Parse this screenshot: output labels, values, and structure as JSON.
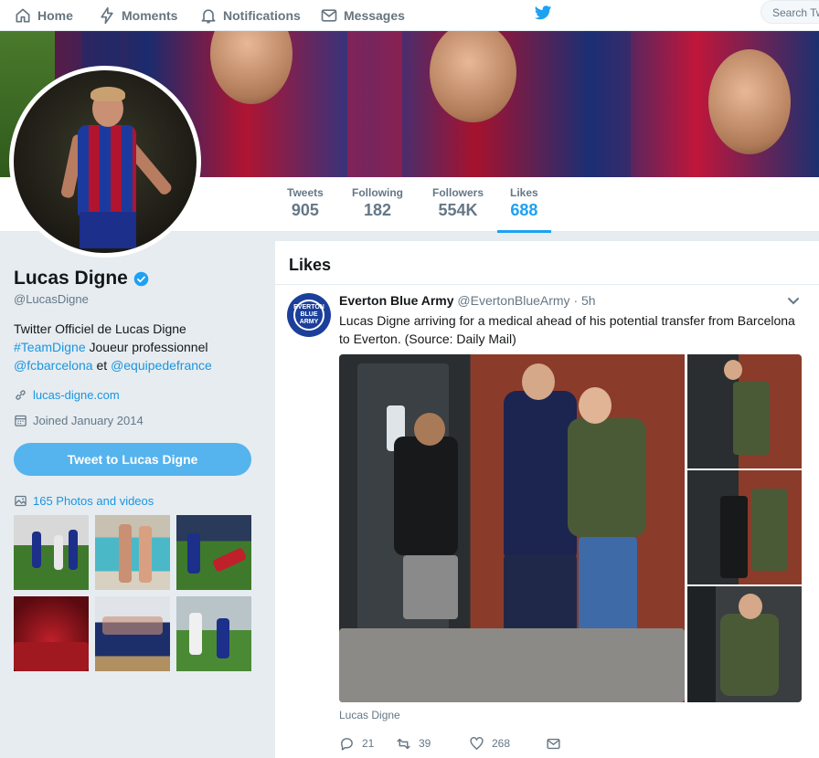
{
  "nav": {
    "home": "Home",
    "moments": "Moments",
    "notifications": "Notifications",
    "messages": "Messages",
    "search_placeholder": "Search Twitter"
  },
  "profile": {
    "name": "Lucas Digne",
    "handle": "@LucasDigne",
    "bio_line1": "Twitter Officiel de Lucas Digne",
    "bio_hashtag": "#TeamDigne",
    "bio_line2_rest": " Joueur professionnel",
    "bio_mention1": "@fcbarcelona",
    "bio_and": " et ",
    "bio_mention2": "@equipedefrance",
    "website": "lucas-digne.com",
    "joined": "Joined January 2014",
    "tweet_to_label": "Tweet to Lucas Digne",
    "photos_label": "165 Photos and videos"
  },
  "stats": [
    {
      "label": "Tweets",
      "value": "905"
    },
    {
      "label": "Following",
      "value": "182"
    },
    {
      "label": "Followers",
      "value": "554K"
    },
    {
      "label": "Likes",
      "value": "688"
    }
  ],
  "timeline": {
    "heading": "Likes",
    "tweet": {
      "author_name": "Everton Blue Army",
      "author_handle": "@EvertonBlueArmy",
      "time": "· 5h",
      "avatar_text": "EVERTON BLUE ARMY",
      "text": "Lucas Digne arriving for a medical ahead of his potential transfer from Barcelona to Everton. (Source: Daily Mail)",
      "media_caption": "Lucas Digne",
      "replies": "21",
      "retweets": "39",
      "likes": "268"
    }
  },
  "colors": {
    "accent": "#1da1f2",
    "link": "#1b95e0",
    "background": "#e6ecf0"
  }
}
